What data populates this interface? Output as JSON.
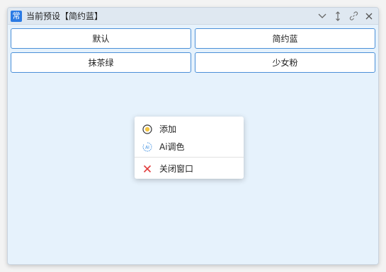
{
  "window": {
    "icon_text": "常",
    "title": "当前预设【简约蓝】",
    "controls": {
      "collapse_icon": "chevron-down-icon",
      "resize_icon": "vertical-resize-icon",
      "pin_icon": "link-icon",
      "close_icon": "close-icon"
    }
  },
  "presets": [
    {
      "label": "默认"
    },
    {
      "label": "简约蓝"
    },
    {
      "label": "抹茶绿"
    },
    {
      "label": "少女粉"
    }
  ],
  "context_menu": {
    "items": [
      {
        "label": "添加",
        "icon": "add-circle-icon"
      },
      {
        "label": "Ai调色",
        "icon": "ai-icon"
      },
      {
        "label": "关闭窗口",
        "icon": "close-x-icon"
      }
    ]
  },
  "colors": {
    "accent": "#2b7be4",
    "button_border": "#4a8fd8",
    "window_bg": "#e6f2fc",
    "close_red": "#e23b3b",
    "add_yellow": "#f4c542"
  }
}
